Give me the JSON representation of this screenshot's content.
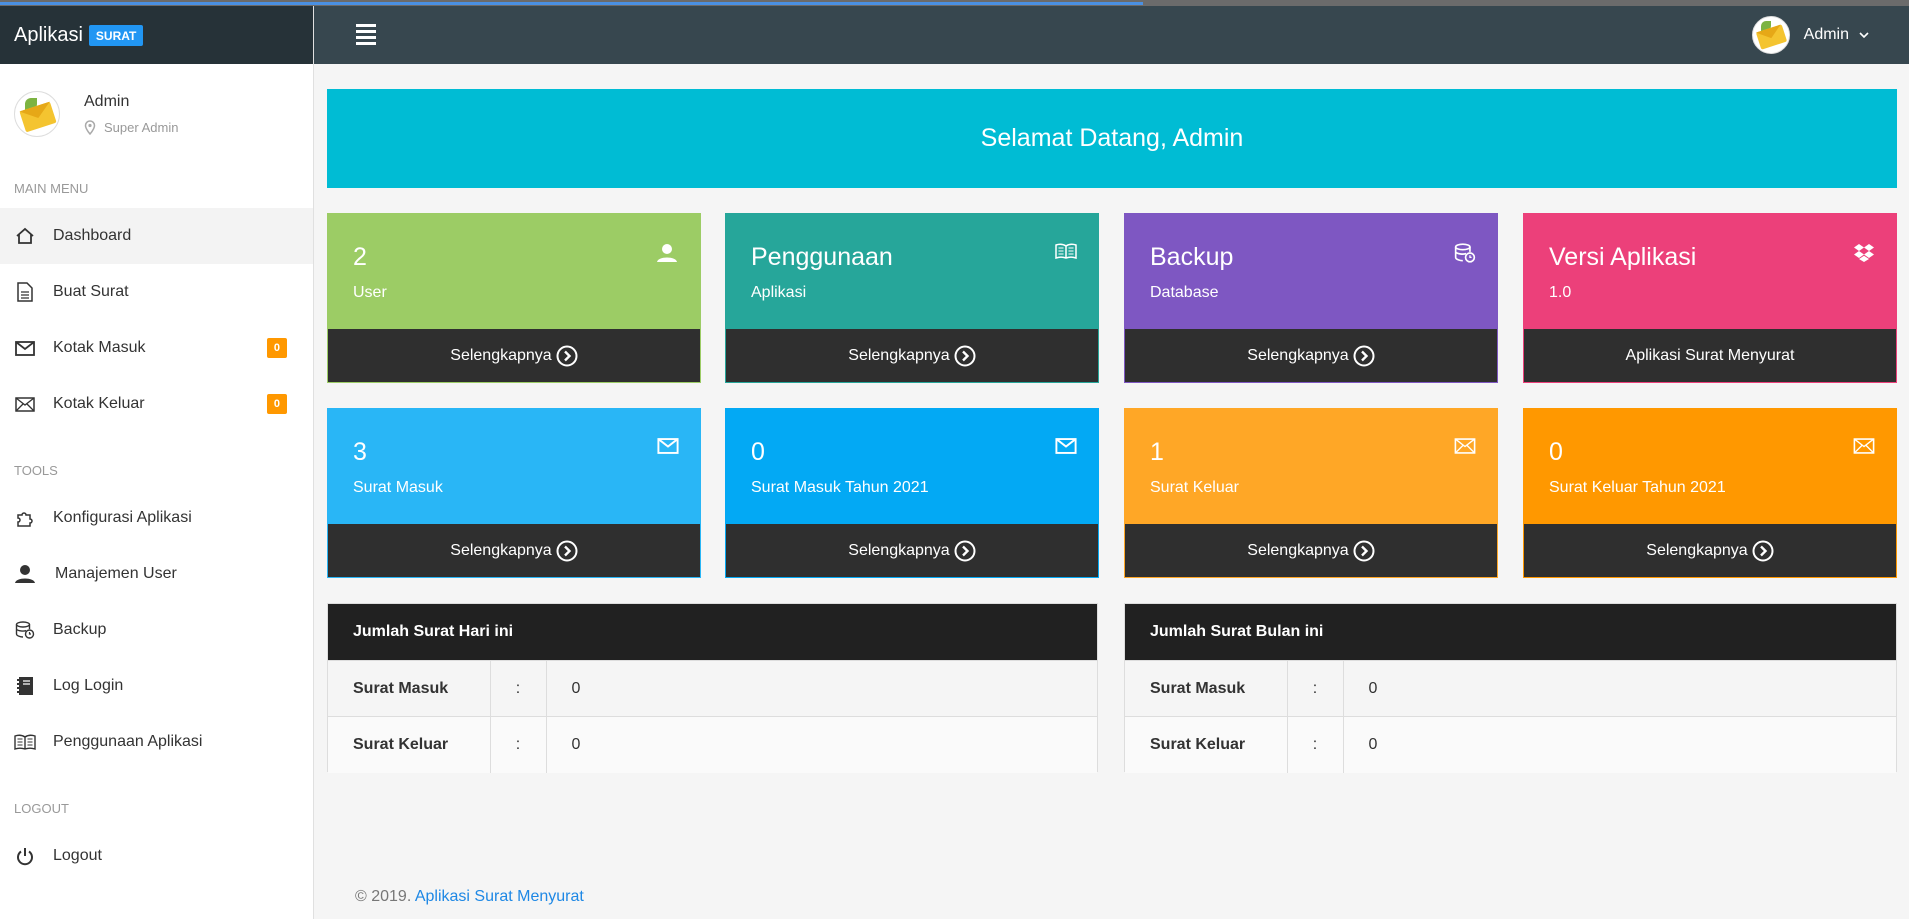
{
  "brand": {
    "name": "Aplikasi",
    "badge": "SURAT"
  },
  "user": {
    "name": "Admin",
    "role": "Super Admin"
  },
  "menu": {
    "main_title": "MAIN MENU",
    "main": [
      {
        "label": "Dashboard",
        "icon": "home-icon"
      },
      {
        "label": "Buat Surat",
        "icon": "document-icon"
      },
      {
        "label": "Kotak Masuk",
        "icon": "mail-icon",
        "count": "0"
      },
      {
        "label": "Kotak Keluar",
        "icon": "mail-open-icon",
        "count": "0"
      }
    ],
    "tools_title": "TOOLS",
    "tools": [
      {
        "label": "Konfigurasi Aplikasi",
        "icon": "puzzle-icon"
      },
      {
        "label": "Manajemen User",
        "icon": "user-icon"
      },
      {
        "label": "Backup",
        "icon": "database-icon"
      },
      {
        "label": "Log Login",
        "icon": "notebook-icon"
      },
      {
        "label": "Penggunaan Aplikasi",
        "icon": "book-icon"
      }
    ],
    "logout_title": "LOGOUT",
    "logout": {
      "label": "Logout",
      "icon": "power-icon"
    }
  },
  "header": {
    "user_name": "Admin"
  },
  "welcome": "Selamat Datang, Admin",
  "cards": [
    {
      "big": "2",
      "sub": "User",
      "footer": "Selengkapnya",
      "color": "#9ccc65",
      "icon": "user-icon"
    },
    {
      "big": "Penggunaan",
      "sub": "Aplikasi",
      "footer": "Selengkapnya",
      "color": "#26a69a",
      "icon": "book-icon"
    },
    {
      "big": "Backup",
      "sub": "Database",
      "footer": "Selengkapnya",
      "color": "#7e57c2",
      "icon": "database-icon"
    },
    {
      "big": "Versi Aplikasi",
      "sub": "1.0",
      "footer": "Aplikasi Surat Menyurat",
      "color": "#ec407a",
      "icon": "dropbox-icon"
    },
    {
      "big": "3",
      "sub": "Surat Masuk",
      "footer": "Selengkapnya",
      "color": "#29b6f6",
      "icon": "mail-icon"
    },
    {
      "big": "0",
      "sub": "Surat Masuk Tahun 2021",
      "footer": "Selengkapnya",
      "color": "#03a9f4",
      "icon": "mail-icon"
    },
    {
      "big": "1",
      "sub": "Surat Keluar",
      "footer": "Selengkapnya",
      "color": "#ffa726",
      "icon": "mail-open-icon"
    },
    {
      "big": "0",
      "sub": "Surat Keluar Tahun 2021",
      "footer": "Selengkapnya",
      "color": "#ff9800",
      "icon": "mail-open-icon"
    }
  ],
  "tables": [
    {
      "title": "Jumlah Surat Hari ini",
      "rows": [
        {
          "label": "Surat Masuk",
          "sep": ":",
          "value": "0"
        },
        {
          "label": "Surat Keluar",
          "sep": ":",
          "value": "0"
        }
      ]
    },
    {
      "title": "Jumlah Surat Bulan ini",
      "rows": [
        {
          "label": "Surat Masuk",
          "sep": ":",
          "value": "0"
        },
        {
          "label": "Surat Keluar",
          "sep": ":",
          "value": "0"
        }
      ]
    }
  ],
  "footer": {
    "copyright": "© 2019. ",
    "link": "Aplikasi Surat Menyurat"
  }
}
